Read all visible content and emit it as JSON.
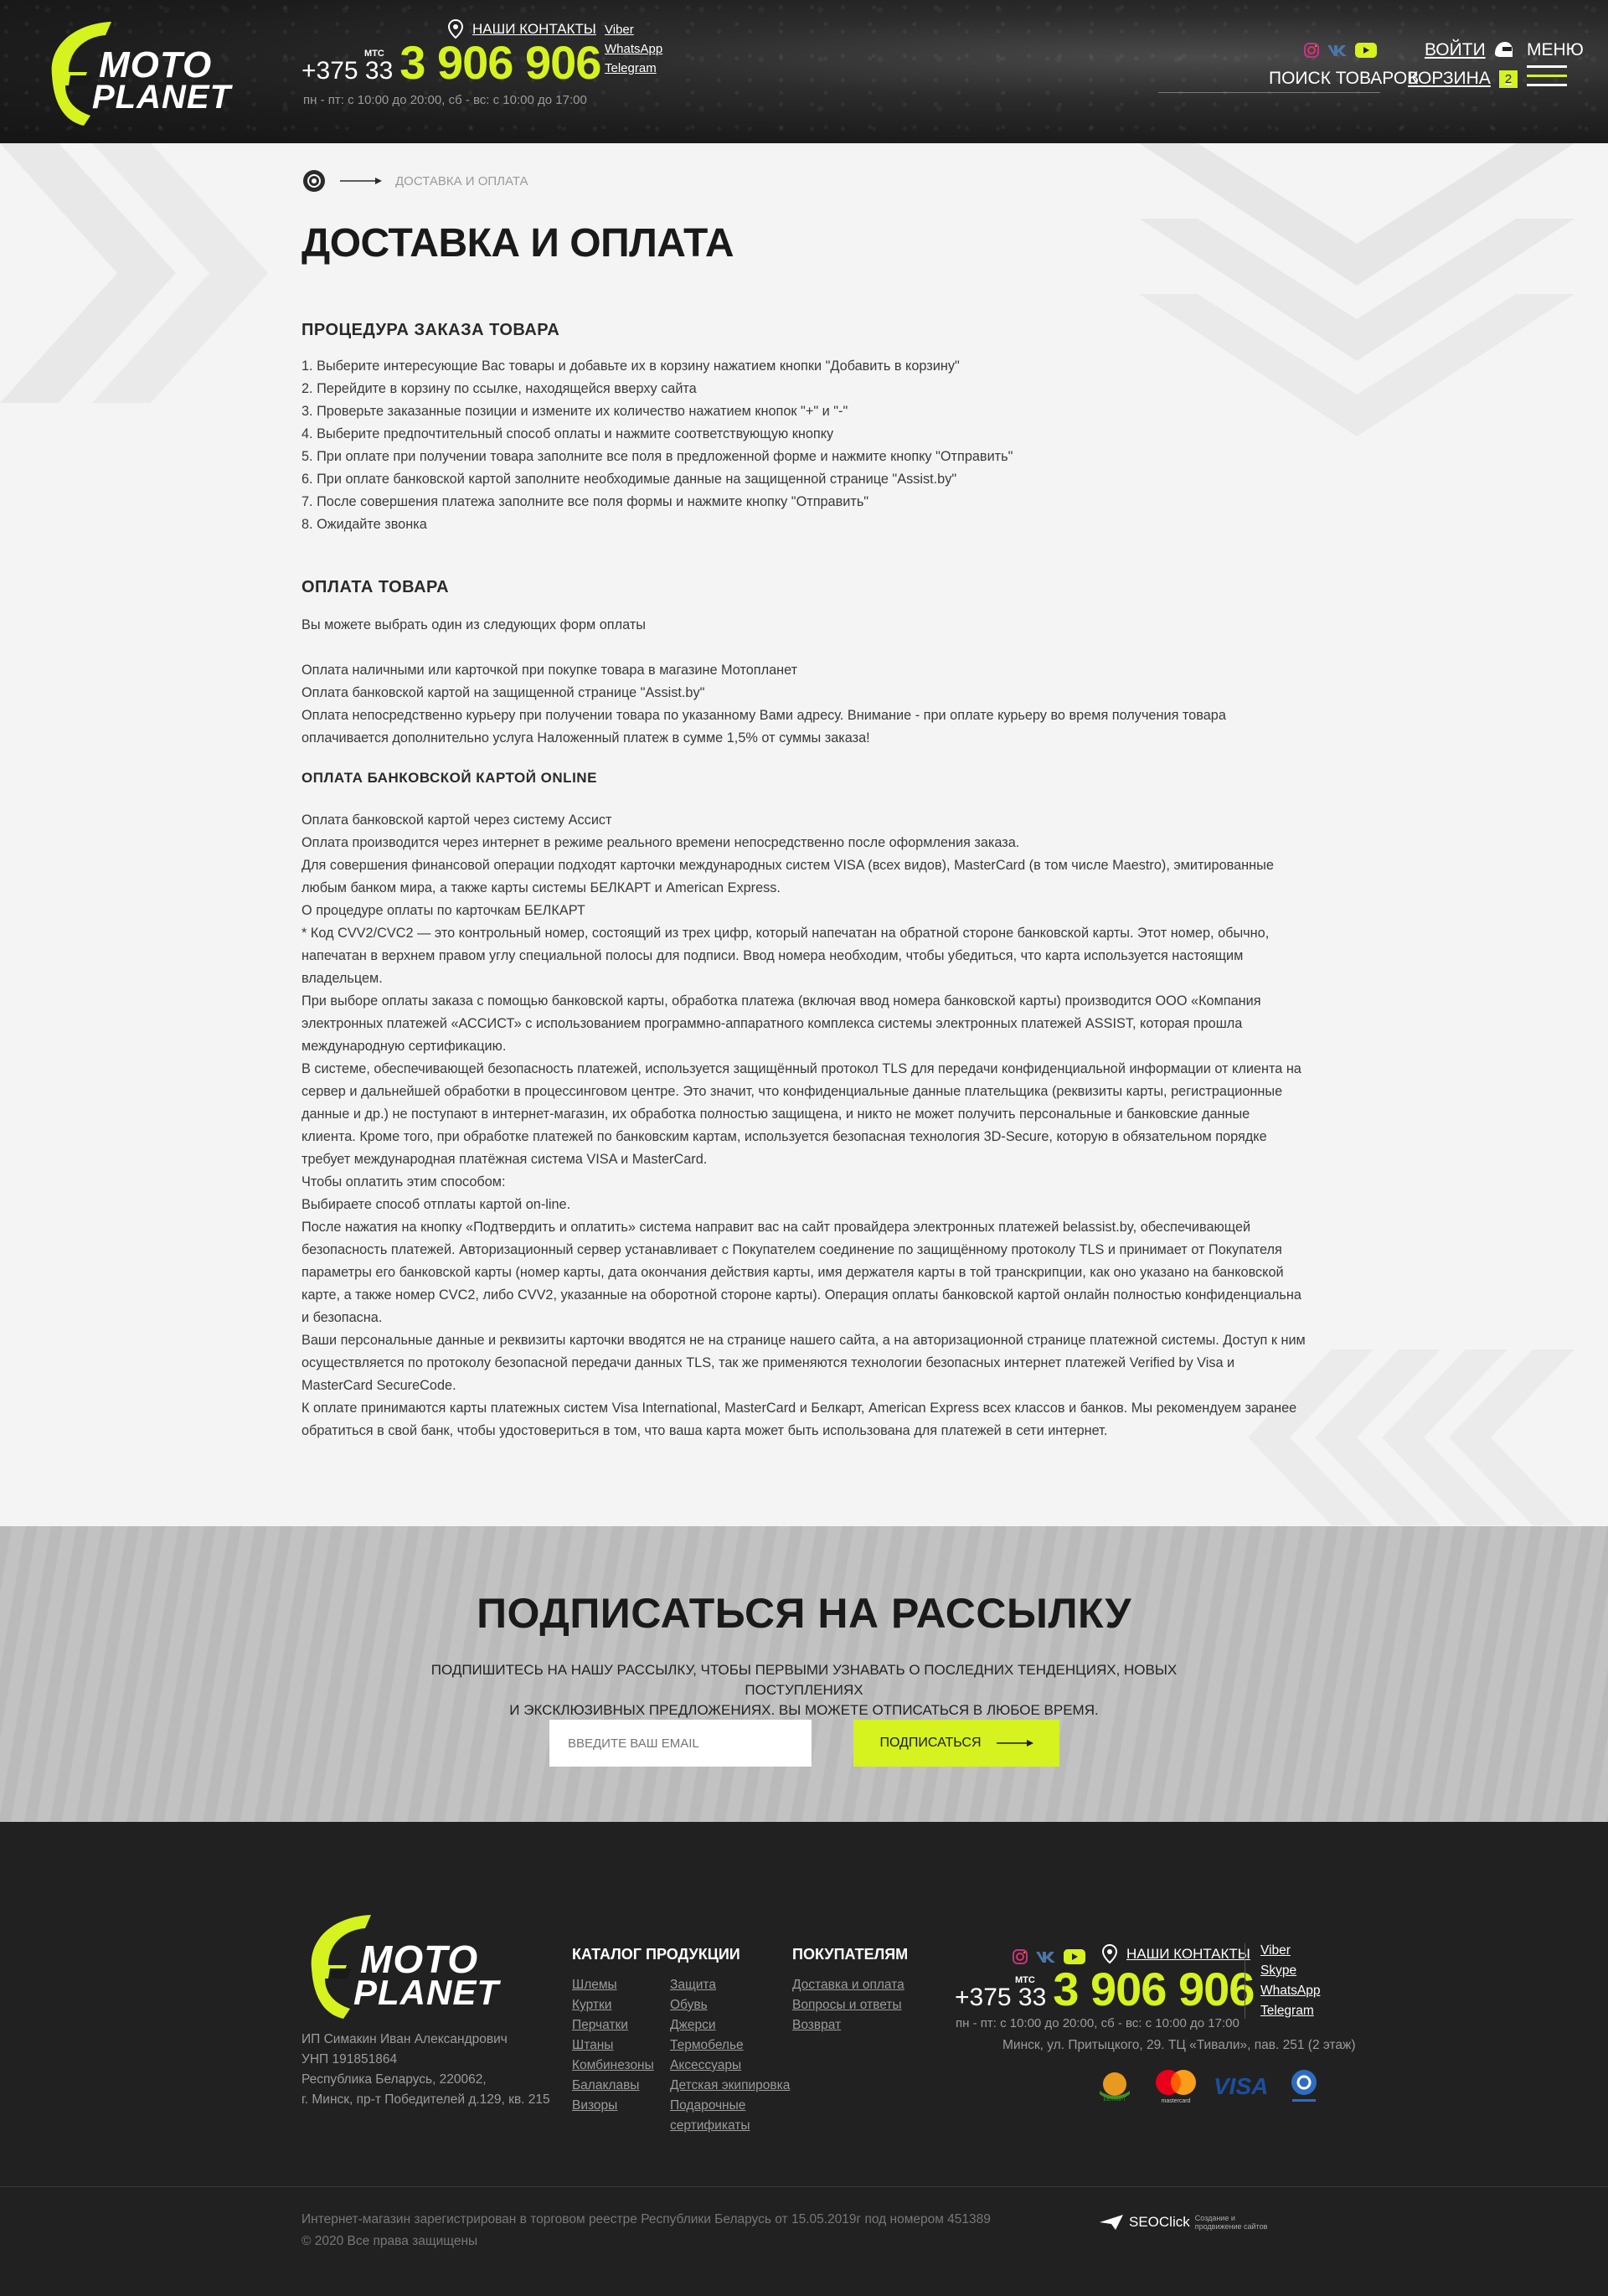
{
  "header": {
    "logo_top": "MOTO",
    "logo_bottom": "PLANET",
    "contacts_link": "НАШИ КОНТАКТЫ",
    "phone_prefix": "+375 33",
    "phone_operator": "МТС",
    "phone_number": "3 906 906",
    "hours": "пн - пт: с 10:00 до 20:00,    сб - вс: с 10:00 до 17:00",
    "messengers": [
      "Viber",
      "WhatsApp",
      "Telegram"
    ],
    "login": "ВОЙТИ",
    "menu": "МЕНЮ",
    "search": "ПОИСК ТОВАРОВ",
    "cart": "КОРЗИНА",
    "cart_count": "2"
  },
  "breadcrumb": {
    "current": "ДОСТАВКА И ОПЛАТА"
  },
  "page_title": "ДОСТАВКА И ОПЛАТА",
  "content": {
    "order_title": "ПРОЦЕДУРА ЗАКАЗА ТОВАРА",
    "order_steps": [
      "1. Выберите интересующие Вас товары и добавьте их в корзину нажатием кнопки \"Добавить в корзину\"",
      "2. Перейдите в корзину по ссылке, находящейся вверху сайта",
      "3. Проверьте заказанные позиции и измените их количество нажатием кнопок \"+\" и \"-\"",
      "4. Выберите предпочтительный способ оплаты и нажмите соответствующую кнопку",
      "5. При оплате при получении товара заполните все поля в предложенной форме и нажмите кнопку \"Отправить\"",
      "6. При оплате банковской картой заполните необходимые данные на защищенной странице \"Assist.by\"",
      "7. После совершения платежа заполните все поля формы и нажмите кнопку \"Отправить\"",
      "8. Ожидайте звонка"
    ],
    "payment_title": "ОПЛАТА ТОВАРА",
    "payment_intro": "Вы можете выбрать один из следующих форм оплаты",
    "payment_options": [
      "Оплата наличными или карточкой при покупке товара в магазине Мотопланет",
      "Оплата банковской картой на защищенной странице \"Assist.by\"",
      "Оплата непосредственно курьеру при получении товара по указанному Вами адресу. Внимание - при оплате курьеру во время получения товара оплачивается дополнительно услуга Наложенный платеж в сумме 1,5% от суммы заказа!"
    ],
    "online_title": "ОПЛАТА БАНКОВСКОЙ КАРТОЙ ONLINE",
    "online_paragraphs": [
      "Оплата банковской картой через систему     Ассист",
      "Оплата производится через интернет в режиме реального времени непосредственно после оформления заказа.",
      "Для совершения финансовой операции подходят карточки международных систем VISA (всех видов), MasterCard (в том числе Maestro), эмитированные любым банком мира, а также карты системы БЕЛКАРТ и American Express.",
      "О процедуре оплаты по карточкам БЕЛКАРТ",
      "* Код CVV2/CVC2 — это контрольный номер, состоящий из трех цифр, который напечатан на обратной стороне банковской карты. Этот номер, обычно, напечатан в верхнем правом углу специальной полосы для подписи. Ввод номера необходим, чтобы убедиться, что карта используется настоящим владельцем.",
      "При выборе оплаты заказа с помощью банковской карты, обработка платежа (включая ввод номера банковской карты) производится ООО «Компания электронных платежей «АССИСТ» с использованием программно-аппаратного комплекса системы электронных платежей ASSIST, которая прошла международную сертификацию.",
      "В системе, обеспечивающей безопасность платежей, используется защищённый протокол TLS для передачи конфиденциальной информации от клиента на сервер и дальнейшей обработки в процессинговом центре. Это значит, что конфиденциальные данные плательщика (реквизиты карты, регистрационные данные и др.) не поступают в интернет-магазин, их обработка полностью защищена, и никто не может получить персональные и банковские данные клиента. Кроме того, при обработке платежей по банковским картам, используется безопасная технология 3D-Secure, которую в обязательном порядке требует международная платёжная система VISA и MasterCard.",
      "Чтобы оплатить этим способом:",
      "Выбираете способ отплаты картой on-line.",
      "После нажатия на кнопку «Подтвердить и оплатить» система направит вас на сайт провайдера электронных платежей belassist.by, обеспечивающей безопасность платежей. Авторизационный сервер устанавливает с Покупателем соединение по защищённому протоколу TLS и принимает от Покупателя параметры его банковской карты (номер карты,  дата окончания действия карты, имя держателя карты в той транскрипции, как оно указано на банковской карте, а также номер CVC2, либо CVV2, указанные на оборотной стороне карты).  Операция оплаты банковской картой онлайн полностью конфиденциальна и безопасна.",
      "Ваши персональные данные и реквизиты карточки вводятся не на странице нашего сайта, а на авторизационной странице платежной системы. Доступ к ним осуществляется по протоколу безопасной передачи данных TLS, так же применяются технологии безопасных интернет платежей Verified by Visa и MasterCard SecureCode.",
      "К оплате принимаются карты платежных систем Visa International, MasterCard и Белкарт, American Express всех классов и банков. Мы рекомендуем заранее обратиться в свой банк, чтобы удостовериться в том, что ваша карта может быть использована для платежей в сети интернет."
    ]
  },
  "subscribe": {
    "title": "ПОДПИСАТЬСЯ НА РАССЫЛКУ",
    "text_line1": "ПОДПИШИТЕСЬ НА НАШУ РАССЫЛКУ, ЧТОБЫ ПЕРВЫМИ УЗНАВАТЬ О ПОСЛЕДНИХ ТЕНДЕНЦИЯХ, НОВЫХ ПОСТУПЛЕНИЯХ",
    "text_line2": "И ЭКСКЛЮЗИВНЫХ ПРЕДЛОЖЕНИЯХ. ВЫ МОЖЕТЕ ОТПИСАТЬСЯ В ЛЮБОЕ ВРЕМЯ.",
    "placeholder": "ВВЕДИТЕ ВАШ EMAIL",
    "button": "ПОДПИСАТЬСЯ"
  },
  "footer": {
    "legal": [
      "ИП Симакин Иван Александрович",
      "УНП 191851864",
      "Республика Беларусь, 220062,",
      "г. Минск, пр-т Победителей д.129, кв. 215"
    ],
    "catalog_title": "КАТАЛОГ ПРОДУКЦИИ",
    "catalog_col1": [
      "Шлемы",
      "Куртки",
      "Перчатки",
      "Штаны",
      "Комбинезоны",
      "Балаклавы",
      "Визоры"
    ],
    "catalog_col2": [
      "Защита",
      "Обувь",
      "Джерси",
      "Термобелье",
      "Аксессуары",
      "Детская экипировка",
      "Подарочные",
      "сертификаты"
    ],
    "buyers_title": "ПОКУПАТЕЛЯМ",
    "buyers_links": [
      "Доставка и оплата",
      "Вопросы и ответы",
      "Возврат"
    ],
    "contacts_link": "НАШИ КОНТАКТЫ",
    "phone_prefix": "+375 33",
    "phone_operator": "МТС",
    "phone_number": "3 906 906",
    "hours": "пн - пт: с 10:00 до 20:00,    сб - вс: с 10:00 до 17:00",
    "address": "Минск, ул. Притыцкого, 29. ТЦ «Тивали», пав. 251 (2 этаж)",
    "messengers": [
      "Viber",
      "Skype",
      "WhatsApp",
      "Telegram"
    ],
    "payment_logo_visa": "VISA",
    "payment_logo_mastercard": "mastercard",
    "payment_logo_belkart": "БЕЛКАРТ",
    "registry": "Интернет-магазин зарегистрирован в торговом реестре Республики Беларусь от 15.05.2019г под номером 451389",
    "copyright": "© 2020 Все права защищены",
    "seo_name": "SEOClick",
    "seo_tagline_1": "Создание и",
    "seo_tagline_2": "продвижение сайтов"
  },
  "colors": {
    "accent": "#d6f21f",
    "header_bg": "#1c1c1c",
    "footer_bg": "#212121",
    "subscribe_bg": "#c2c2c2"
  }
}
